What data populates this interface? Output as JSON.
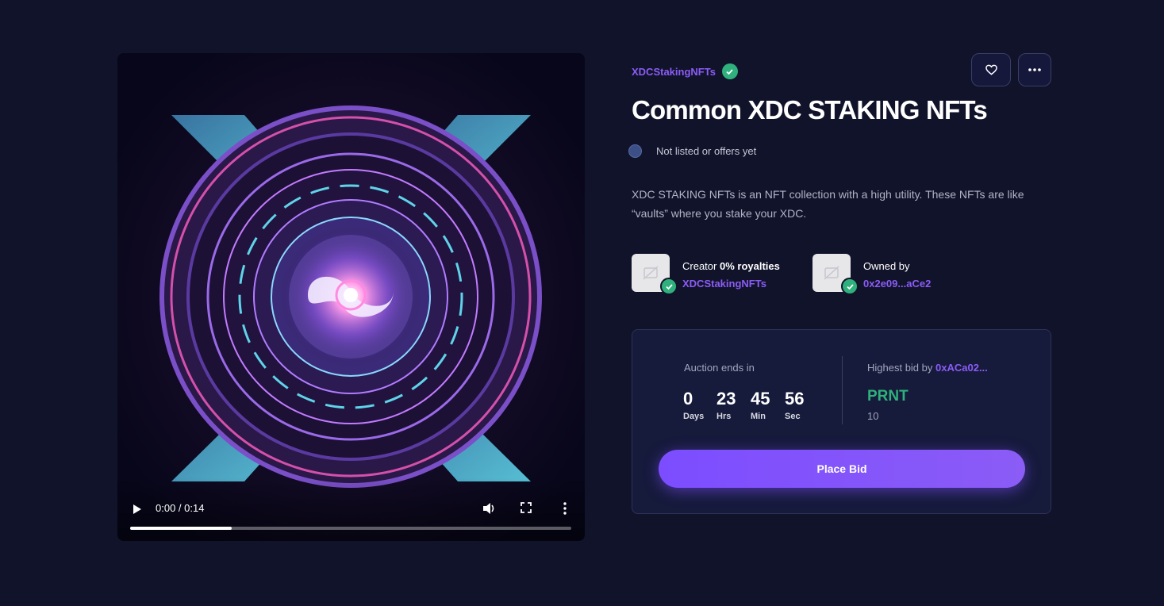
{
  "media": {
    "current_time": "0:00",
    "duration": "0:14",
    "progress_fraction": 0.23
  },
  "collection": {
    "name": "XDCStakingNFTs",
    "verified": true
  },
  "actions": {
    "favorite_icon": "heart-icon",
    "more_icon": "ellipsis-icon"
  },
  "title": "Common XDC STAKING NFTs",
  "status": {
    "text": "Not listed or offers yet"
  },
  "description": "XDC STAKING NFTs is an NFT collection with a high utility. These NFTs are like “vaults” where you stake your XDC.",
  "creator": {
    "label": "Creator",
    "royalties": "0% royalties",
    "name": "XDCStakingNFTs"
  },
  "owner": {
    "label": "Owned by",
    "address": "0x2e09...aCe2"
  },
  "auction": {
    "label": "Auction ends in",
    "countdown": [
      {
        "value": "0",
        "unit": "Days"
      },
      {
        "value": "23",
        "unit": "Hrs"
      },
      {
        "value": "45",
        "unit": "Min"
      },
      {
        "value": "56",
        "unit": "Sec"
      }
    ]
  },
  "bid": {
    "label": "Highest bid by",
    "bidder": "0xACa02...",
    "token": "PRNT",
    "amount": "10"
  },
  "place_bid_label": "Place Bid",
  "colors": {
    "background": "#11132a",
    "accent": "#8b5cf6",
    "success": "#2fb07c"
  }
}
